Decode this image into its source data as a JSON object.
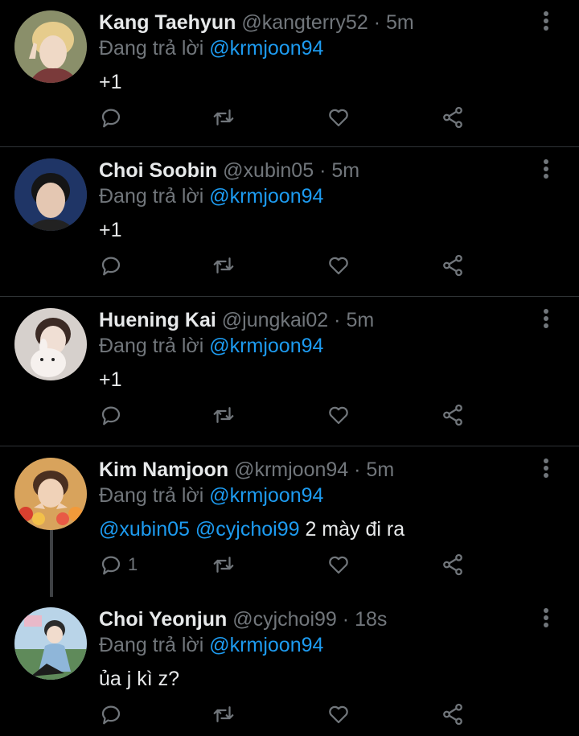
{
  "reply_prefix": "Đang trả lời",
  "tweets": [
    {
      "name": "Kang Taehyun",
      "handle": "@kangterry52",
      "separator": "·",
      "time": "5m",
      "reply_to": "@krmjoon94",
      "text_mentions": [],
      "text": "+1",
      "reply_count": "",
      "avatar_colors": [
        "#c9a66b",
        "#e8d7c3",
        "#6a4a35"
      ]
    },
    {
      "name": "Choi Soobin",
      "handle": "@xubin05",
      "separator": "·",
      "time": "5m",
      "reply_to": "@krmjoon94",
      "text_mentions": [],
      "text": "+1",
      "reply_count": "",
      "avatar_colors": [
        "#2a3a6a",
        "#e6c9b4",
        "#1b1b1b"
      ]
    },
    {
      "name": "Huening Kai",
      "handle": "@jungkai02",
      "separator": "·",
      "time": "5m",
      "reply_to": "@krmjoon94",
      "text_mentions": [],
      "text": "+1",
      "reply_count": "",
      "avatar_colors": [
        "#d9d3cf",
        "#f2e6df",
        "#3b2a24"
      ]
    },
    {
      "name": "Kim Namjoon",
      "handle": "@krmjoon94",
      "separator": "·",
      "time": "5m",
      "reply_to": "@krmjoon94",
      "text_mentions": [
        "@xubin05",
        "@cyjchoi99"
      ],
      "text": " 2 mày đi ra",
      "reply_count": "1",
      "avatar_colors": [
        "#e3b16a",
        "#f0d2b8",
        "#4a2f20"
      ]
    },
    {
      "name": "Choi Yeonjun",
      "handle": "@cyjchoi99",
      "separator": "·",
      "time": "18s",
      "reply_to": "@krmjoon94",
      "text_mentions": [],
      "text": "ủa j kì z?",
      "reply_count": "",
      "avatar_colors": [
        "#8fb6d9",
        "#f1dccd",
        "#2b2b2b"
      ]
    }
  ],
  "icons": {
    "reply": "reply-icon",
    "retweet": "retweet-icon",
    "like": "heart-icon",
    "share": "share-icon",
    "more": "more-vertical-icon"
  },
  "colors": {
    "background": "#000000",
    "text": "#e7e9ea",
    "muted": "#71767b",
    "link": "#1d9bf0",
    "divider": "#2f3336"
  }
}
